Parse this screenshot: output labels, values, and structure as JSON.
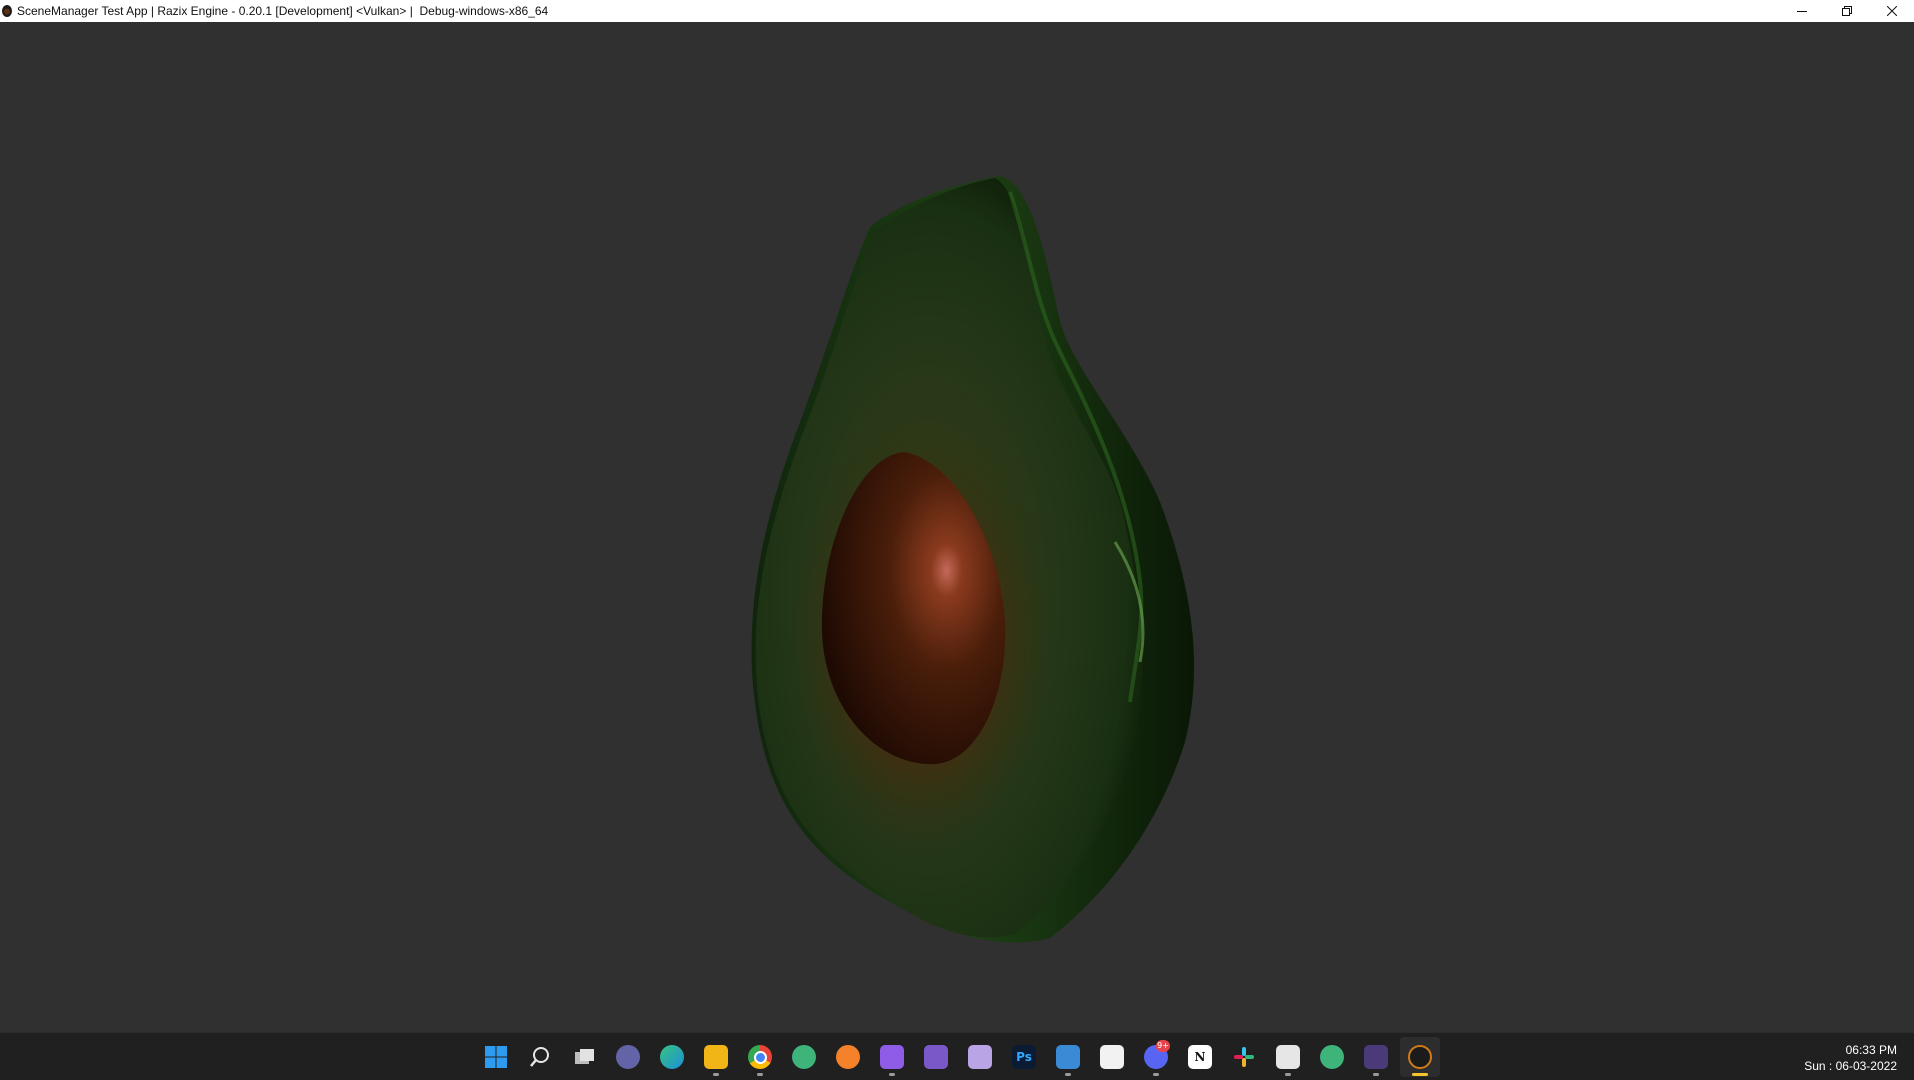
{
  "window": {
    "title": "SceneManager Test App | Razix Engine - 0.20.1 [Development] <Vulkan> |  Debug-windows-x86_64",
    "controls": {
      "minimize_icon": "minimize-icon",
      "restore_icon": "restore-icon",
      "close_icon": "close-icon"
    }
  },
  "viewport": {
    "background_color": "#303030",
    "scene_object": "avocado-model"
  },
  "taskbar": {
    "icons": [
      {
        "name": "start",
        "icon": "windows-start-icon",
        "color": "#2d9bf0",
        "glyph": "",
        "running": false,
        "active": false
      },
      {
        "name": "search",
        "icon": "search-icon",
        "color": "transparent",
        "glyph": "",
        "running": false,
        "active": false
      },
      {
        "name": "task-view",
        "icon": "task-view-icon",
        "color": "#d0d0d0",
        "glyph": "",
        "running": false,
        "active": false
      },
      {
        "name": "teams-chat",
        "icon": "teams-chat-icon",
        "color": "#6264a7",
        "glyph": "",
        "running": false,
        "active": false
      },
      {
        "name": "edge",
        "icon": "edge-icon",
        "color": "#1c8fd8",
        "glyph": "",
        "running": false,
        "active": false
      },
      {
        "name": "file-explorer",
        "icon": "file-explorer-icon",
        "color": "#f2b518",
        "glyph": "",
        "running": true,
        "active": false
      },
      {
        "name": "chrome",
        "icon": "chrome-icon",
        "color": "#e84336",
        "glyph": "",
        "running": true,
        "active": false
      },
      {
        "name": "atom-app",
        "icon": "atom-icon",
        "color": "#3eb37a",
        "glyph": "",
        "running": false,
        "active": false
      },
      {
        "name": "blender",
        "icon": "blender-icon",
        "color": "#f5822a",
        "glyph": "",
        "running": false,
        "active": false
      },
      {
        "name": "visual-studio-2022",
        "icon": "visual-studio-icon",
        "color": "#8e5ce6",
        "glyph": "",
        "running": true,
        "active": false
      },
      {
        "name": "visual-studio-2019",
        "icon": "visual-studio-2019-icon",
        "color": "#7a58c8",
        "glyph": "",
        "running": false,
        "active": false
      },
      {
        "name": "visual-studio-preview",
        "icon": "visual-studio-preview-icon",
        "color": "#b9a4e6",
        "glyph": "",
        "running": false,
        "active": false
      },
      {
        "name": "photoshop",
        "icon": "photoshop-icon",
        "color": "#0b1b33",
        "glyph": "Ps",
        "running": false,
        "active": false
      },
      {
        "name": "notepad",
        "icon": "notepad-icon",
        "color": "#3a8ad6",
        "glyph": "",
        "running": true,
        "active": false
      },
      {
        "name": "unity",
        "icon": "unity-icon",
        "color": "#f2f2f2",
        "glyph": "",
        "running": false,
        "active": false
      },
      {
        "name": "discord",
        "icon": "discord-icon",
        "color": "#5865f2",
        "glyph": "",
        "running": true,
        "active": false,
        "badge": "9+"
      },
      {
        "name": "notion",
        "icon": "notion-icon",
        "color": "#ffffff",
        "glyph": "N",
        "running": false,
        "active": false
      },
      {
        "name": "slack",
        "icon": "slack-icon",
        "color": "#ffffff",
        "glyph": "",
        "running": false,
        "active": false
      },
      {
        "name": "razix-editor",
        "icon": "razix-editor-icon",
        "color": "#e6e6e6",
        "glyph": "",
        "running": true,
        "active": false
      },
      {
        "name": "atom-app-2",
        "icon": "atom-icon",
        "color": "#3eb37a",
        "glyph": "",
        "running": false,
        "active": false
      },
      {
        "name": "terminal",
        "icon": "terminal-icon",
        "color": "#4a3a7a",
        "glyph": "",
        "running": true,
        "active": false
      },
      {
        "name": "razix-app",
        "icon": "razix-app-icon",
        "color": "#1b1b1b",
        "glyph": "",
        "running": true,
        "active": true
      }
    ]
  },
  "clock": {
    "time": "06:33 PM",
    "date": "Sun : 06-03-2022"
  }
}
